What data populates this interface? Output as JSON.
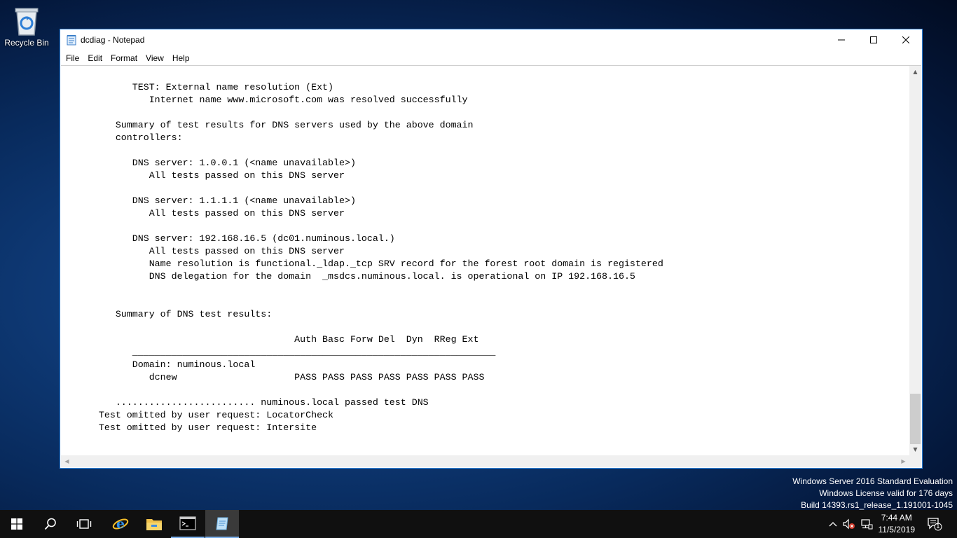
{
  "desktop": {
    "recycle_bin_label": "Recycle Bin"
  },
  "window": {
    "title": "dcdiag - Notepad",
    "menu": [
      "File",
      "Edit",
      "Format",
      "View",
      "Help"
    ]
  },
  "editor": {
    "lines": [
      "            TEST: External name resolution (Ext)",
      "               Internet name www.microsoft.com was resolved successfully",
      "",
      "         Summary of test results for DNS servers used by the above domain",
      "         controllers:",
      "",
      "            DNS server: 1.0.0.1 (<name unavailable>)",
      "               All tests passed on this DNS server",
      "",
      "            DNS server: 1.1.1.1 (<name unavailable>)",
      "               All tests passed on this DNS server",
      "",
      "            DNS server: 192.168.16.5 (dc01.numinous.local.)",
      "               All tests passed on this DNS server",
      "               Name resolution is functional._ldap._tcp SRV record for the forest root domain is registered",
      "               DNS delegation for the domain  _msdcs.numinous.local. is operational on IP 192.168.16.5",
      "",
      "",
      "         Summary of DNS test results:",
      "",
      "                                         Auth Basc Forw Del  Dyn  RReg Ext",
      "            _________________________________________________________________",
      "            Domain: numinous.local",
      "               dcnew                     PASS PASS PASS PASS PASS PASS PASS",
      "",
      "         ......................... numinous.local passed test DNS",
      "      Test omitted by user request: LocatorCheck",
      "      Test omitted by user request: Intersite"
    ]
  },
  "watermark": {
    "line1": "Windows Server 2016 Standard Evaluation",
    "line2": "Windows License valid for 176 days",
    "line3": "Build 14393.rs1_release_1.191001-1045"
  },
  "taskbar": {
    "time": "7:44 AM",
    "date": "11/5/2019",
    "notification_count": "1"
  },
  "colors": {
    "accent": "#2b7fd6",
    "taskbar": "#101010"
  }
}
